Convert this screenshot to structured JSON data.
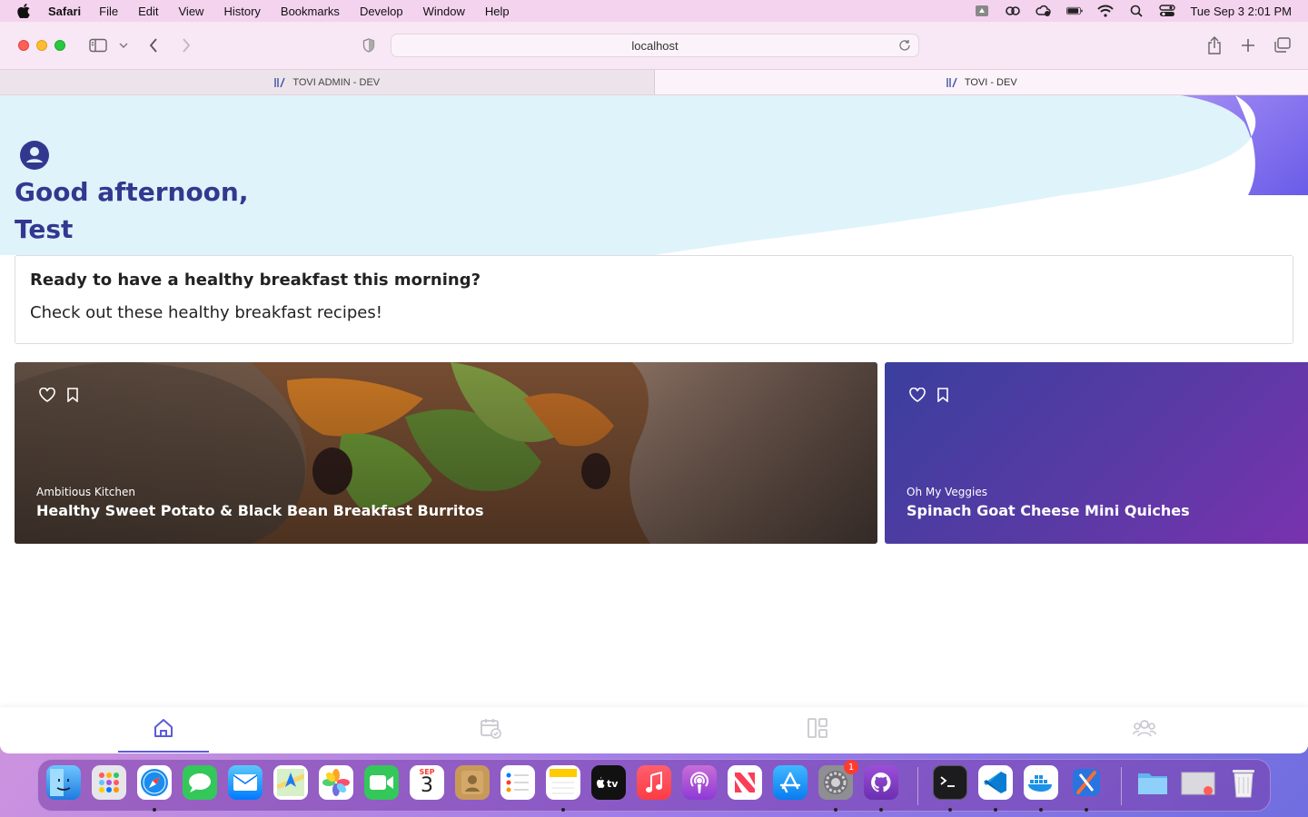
{
  "menubar": {
    "app_name": "Safari",
    "items": [
      "File",
      "Edit",
      "View",
      "History",
      "Bookmarks",
      "Develop",
      "Window",
      "Help"
    ],
    "clock": "Tue Sep 3  2:01 PM"
  },
  "browser": {
    "url": "localhost",
    "tabs": [
      {
        "label": "TOVI ADMIN - DEV",
        "active": false
      },
      {
        "label": "TOVI - DEV",
        "active": true
      }
    ]
  },
  "page": {
    "greeting_line1": "Good afternoon,",
    "greeting_line2": "Test",
    "prompt_title": "Ready to have a healthy breakfast this morning?",
    "prompt_subtitle": "Check out these healthy breakfast recipes!",
    "recipes": [
      {
        "source": "Ambitious Kitchen",
        "title": "Healthy Sweet Potato & Black Bean Breakfast Burritos"
      },
      {
        "source": "Oh My Veggies",
        "title": "Spinach Goat Cheese Mini Quiches"
      }
    ],
    "bottom_nav": [
      "home-icon",
      "calendar-check-icon",
      "dashboard-icon",
      "community-icon"
    ]
  },
  "dock": {
    "calendar_month": "SEP",
    "calendar_day": "3",
    "settings_badge": "1",
    "apps": [
      "Finder",
      "Launchpad",
      "Safari",
      "Messages",
      "Mail",
      "Maps",
      "Photos",
      "FaceTime",
      "Calendar",
      "Contacts",
      "Reminders",
      "Notes",
      "TV",
      "Music",
      "Podcasts",
      "News",
      "App Store",
      "System Settings",
      "GitHub Desktop",
      "Terminal",
      "Visual Studio Code",
      "Docker",
      "Xcode",
      "Downloads",
      "Screenshot",
      "Trash"
    ]
  },
  "colors": {
    "brand": "#33388f",
    "hero_bg": "#dff3fb",
    "hero_accent": "#7a6ff0",
    "nav_active": "#5b5cd6"
  }
}
